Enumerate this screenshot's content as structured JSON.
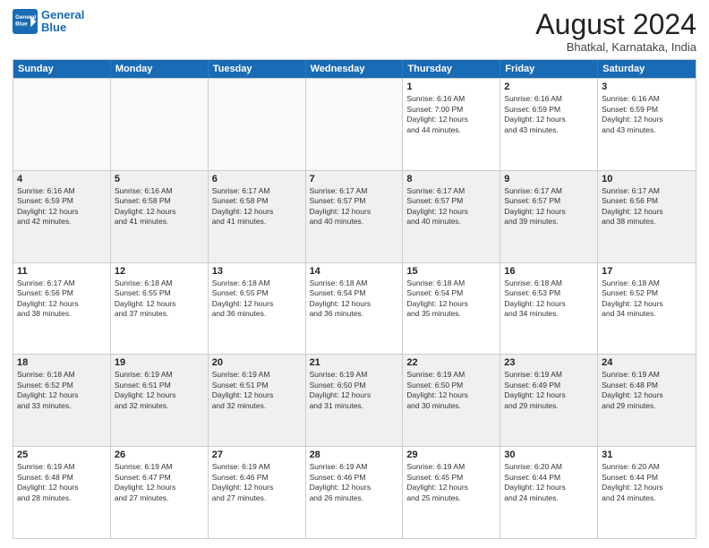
{
  "header": {
    "logo_line1": "General",
    "logo_line2": "Blue",
    "month_year": "August 2024",
    "location": "Bhatkal, Karnataka, India"
  },
  "weekdays": [
    "Sunday",
    "Monday",
    "Tuesday",
    "Wednesday",
    "Thursday",
    "Friday",
    "Saturday"
  ],
  "rows": [
    [
      {
        "day": "",
        "info": "",
        "empty": true
      },
      {
        "day": "",
        "info": "",
        "empty": true
      },
      {
        "day": "",
        "info": "",
        "empty": true
      },
      {
        "day": "",
        "info": "",
        "empty": true
      },
      {
        "day": "1",
        "info": "Sunrise: 6:16 AM\nSunset: 7:00 PM\nDaylight: 12 hours\nand 44 minutes.",
        "empty": false
      },
      {
        "day": "2",
        "info": "Sunrise: 6:16 AM\nSunset: 6:59 PM\nDaylight: 12 hours\nand 43 minutes.",
        "empty": false
      },
      {
        "day": "3",
        "info": "Sunrise: 6:16 AM\nSunset: 6:59 PM\nDaylight: 12 hours\nand 43 minutes.",
        "empty": false
      }
    ],
    [
      {
        "day": "4",
        "info": "Sunrise: 6:16 AM\nSunset: 6:59 PM\nDaylight: 12 hours\nand 42 minutes.",
        "empty": false
      },
      {
        "day": "5",
        "info": "Sunrise: 6:16 AM\nSunset: 6:58 PM\nDaylight: 12 hours\nand 41 minutes.",
        "empty": false
      },
      {
        "day": "6",
        "info": "Sunrise: 6:17 AM\nSunset: 6:58 PM\nDaylight: 12 hours\nand 41 minutes.",
        "empty": false
      },
      {
        "day": "7",
        "info": "Sunrise: 6:17 AM\nSunset: 6:57 PM\nDaylight: 12 hours\nand 40 minutes.",
        "empty": false
      },
      {
        "day": "8",
        "info": "Sunrise: 6:17 AM\nSunset: 6:57 PM\nDaylight: 12 hours\nand 40 minutes.",
        "empty": false
      },
      {
        "day": "9",
        "info": "Sunrise: 6:17 AM\nSunset: 6:57 PM\nDaylight: 12 hours\nand 39 minutes.",
        "empty": false
      },
      {
        "day": "10",
        "info": "Sunrise: 6:17 AM\nSunset: 6:56 PM\nDaylight: 12 hours\nand 38 minutes.",
        "empty": false
      }
    ],
    [
      {
        "day": "11",
        "info": "Sunrise: 6:17 AM\nSunset: 6:56 PM\nDaylight: 12 hours\nand 38 minutes.",
        "empty": false
      },
      {
        "day": "12",
        "info": "Sunrise: 6:18 AM\nSunset: 6:55 PM\nDaylight: 12 hours\nand 37 minutes.",
        "empty": false
      },
      {
        "day": "13",
        "info": "Sunrise: 6:18 AM\nSunset: 6:55 PM\nDaylight: 12 hours\nand 36 minutes.",
        "empty": false
      },
      {
        "day": "14",
        "info": "Sunrise: 6:18 AM\nSunset: 6:54 PM\nDaylight: 12 hours\nand 36 minutes.",
        "empty": false
      },
      {
        "day": "15",
        "info": "Sunrise: 6:18 AM\nSunset: 6:54 PM\nDaylight: 12 hours\nand 35 minutes.",
        "empty": false
      },
      {
        "day": "16",
        "info": "Sunrise: 6:18 AM\nSunset: 6:53 PM\nDaylight: 12 hours\nand 34 minutes.",
        "empty": false
      },
      {
        "day": "17",
        "info": "Sunrise: 6:18 AM\nSunset: 6:52 PM\nDaylight: 12 hours\nand 34 minutes.",
        "empty": false
      }
    ],
    [
      {
        "day": "18",
        "info": "Sunrise: 6:18 AM\nSunset: 6:52 PM\nDaylight: 12 hours\nand 33 minutes.",
        "empty": false
      },
      {
        "day": "19",
        "info": "Sunrise: 6:19 AM\nSunset: 6:51 PM\nDaylight: 12 hours\nand 32 minutes.",
        "empty": false
      },
      {
        "day": "20",
        "info": "Sunrise: 6:19 AM\nSunset: 6:51 PM\nDaylight: 12 hours\nand 32 minutes.",
        "empty": false
      },
      {
        "day": "21",
        "info": "Sunrise: 6:19 AM\nSunset: 6:50 PM\nDaylight: 12 hours\nand 31 minutes.",
        "empty": false
      },
      {
        "day": "22",
        "info": "Sunrise: 6:19 AM\nSunset: 6:50 PM\nDaylight: 12 hours\nand 30 minutes.",
        "empty": false
      },
      {
        "day": "23",
        "info": "Sunrise: 6:19 AM\nSunset: 6:49 PM\nDaylight: 12 hours\nand 29 minutes.",
        "empty": false
      },
      {
        "day": "24",
        "info": "Sunrise: 6:19 AM\nSunset: 6:48 PM\nDaylight: 12 hours\nand 29 minutes.",
        "empty": false
      }
    ],
    [
      {
        "day": "25",
        "info": "Sunrise: 6:19 AM\nSunset: 6:48 PM\nDaylight: 12 hours\nand 28 minutes.",
        "empty": false
      },
      {
        "day": "26",
        "info": "Sunrise: 6:19 AM\nSunset: 6:47 PM\nDaylight: 12 hours\nand 27 minutes.",
        "empty": false
      },
      {
        "day": "27",
        "info": "Sunrise: 6:19 AM\nSunset: 6:46 PM\nDaylight: 12 hours\nand 27 minutes.",
        "empty": false
      },
      {
        "day": "28",
        "info": "Sunrise: 6:19 AM\nSunset: 6:46 PM\nDaylight: 12 hours\nand 26 minutes.",
        "empty": false
      },
      {
        "day": "29",
        "info": "Sunrise: 6:19 AM\nSunset: 6:45 PM\nDaylight: 12 hours\nand 25 minutes.",
        "empty": false
      },
      {
        "day": "30",
        "info": "Sunrise: 6:20 AM\nSunset: 6:44 PM\nDaylight: 12 hours\nand 24 minutes.",
        "empty": false
      },
      {
        "day": "31",
        "info": "Sunrise: 6:20 AM\nSunset: 6:44 PM\nDaylight: 12 hours\nand 24 minutes.",
        "empty": false
      }
    ]
  ]
}
